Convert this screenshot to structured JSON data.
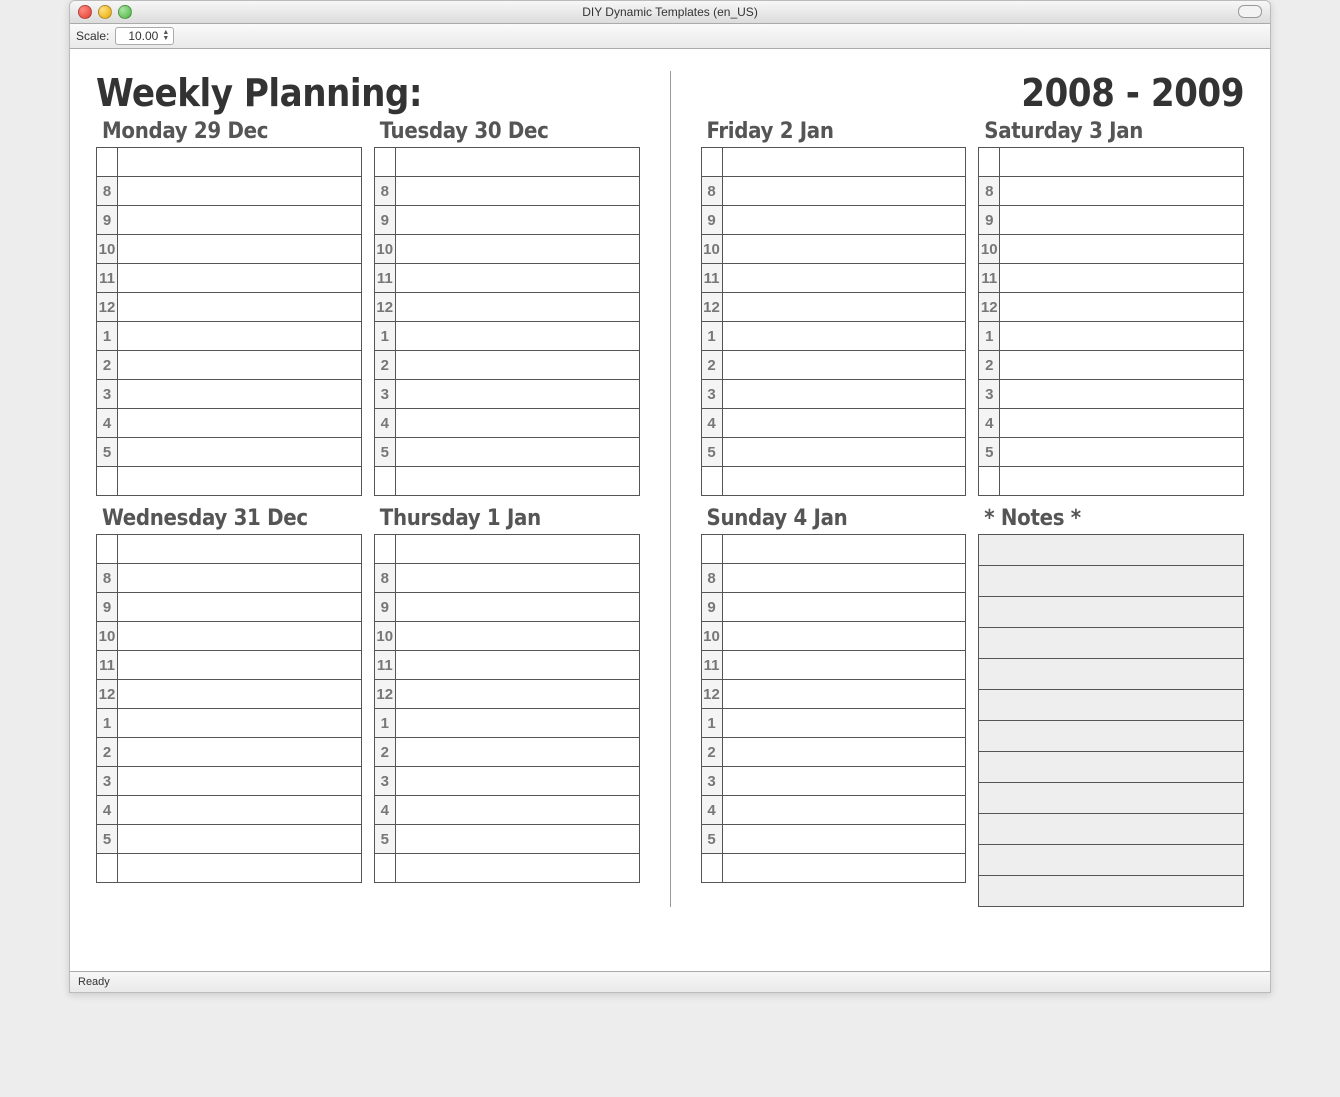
{
  "window": {
    "title": "DIY Dynamic Templates (en_US)"
  },
  "toolbar": {
    "scale_label": "Scale:",
    "scale_value": "10.00"
  },
  "planner": {
    "title_left": "Weekly Planning:",
    "title_right": "2008 - 2009",
    "hours": [
      "",
      "8",
      "9",
      "10",
      "11",
      "12",
      "1",
      "2",
      "3",
      "4",
      "5",
      ""
    ],
    "days_left": [
      {
        "label": "Monday 29 Dec"
      },
      {
        "label": "Tuesday 30 Dec"
      },
      {
        "label": "Wednesday 31 Dec"
      },
      {
        "label": "Thursday 1 Jan"
      }
    ],
    "days_right": [
      {
        "label": "Friday 2 Jan"
      },
      {
        "label": "Saturday 3 Jan"
      },
      {
        "label": "Sunday 4 Jan"
      }
    ],
    "notes_label": "* Notes *",
    "notes_rows": 12
  },
  "status": {
    "text": "Ready"
  }
}
